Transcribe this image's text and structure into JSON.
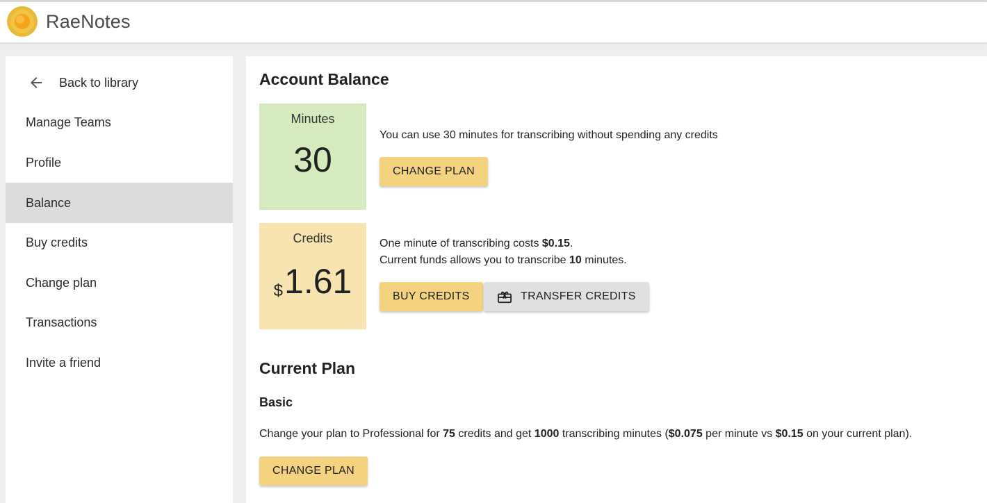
{
  "app": {
    "name": "RaeNotes"
  },
  "sidebar": {
    "back_label": "Back to library",
    "items": [
      {
        "label": "Manage Teams"
      },
      {
        "label": "Profile"
      },
      {
        "label": "Balance"
      },
      {
        "label": "Buy credits"
      },
      {
        "label": "Change plan"
      },
      {
        "label": "Transactions"
      },
      {
        "label": "Invite a friend"
      }
    ],
    "active": "Balance"
  },
  "account_balance": {
    "title": "Account Balance",
    "minutes": {
      "label": "Minutes",
      "value": "30",
      "description": "You can use 30 minutes for transcribing without spending any credits",
      "button": "CHANGE PLAN"
    },
    "credits": {
      "label": "Credits",
      "currency": "$",
      "value": "1.61",
      "line1_prefix": "One minute of transcribing costs ",
      "line1_price": "$0.15",
      "line1_suffix": ".",
      "line2_prefix": "Current funds allows you to transcribe ",
      "line2_count": "10",
      "line2_suffix": " minutes.",
      "buy_button": "BUY CREDITS",
      "transfer_button": "TRANSFER CREDITS"
    }
  },
  "current_plan": {
    "title": "Current Plan",
    "name": "Basic",
    "desc": {
      "p1": "Change your plan to Professional for ",
      "credits": "75",
      "p2": " credits and get ",
      "minutes": "1000",
      "p3": " transcribing minutes (",
      "pro_price": "$0.075",
      "p4": " per minute vs ",
      "cur_price": "$0.15",
      "p5": " on your current plan)."
    },
    "button": "CHANGE PLAN"
  },
  "colors": {
    "accent_button": "#f3d37f",
    "minutes_tile": "#d5ebbf",
    "credits_tile": "#f7e4b0",
    "active_nav": "#dcdcdc"
  },
  "icons": {
    "logo": "raenotes-logo-icon",
    "back": "arrow-left-icon",
    "transfer": "gift-card-icon"
  }
}
